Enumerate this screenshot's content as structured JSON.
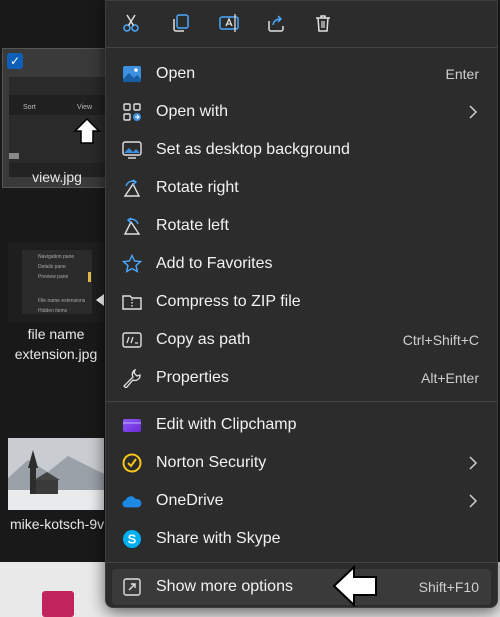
{
  "files": [
    {
      "name": "view.jpg",
      "selected": true
    },
    {
      "name": "file name extension.jpg",
      "name_line1": "file name",
      "name_line2": "extension.jpg",
      "selected": false
    },
    {
      "name": "mike-kotsch-9v",
      "selected": false
    }
  ],
  "thumb1": {
    "sort": "Sort",
    "view": "View"
  },
  "thumb2": {
    "items": [
      "Navigation pane",
      "Details pane",
      "Preview pane",
      "File name extensions",
      "Hidden items"
    ]
  },
  "quick_actions": [
    {
      "name": "cut-icon"
    },
    {
      "name": "copy-icon"
    },
    {
      "name": "rename-icon"
    },
    {
      "name": "share-icon"
    },
    {
      "name": "delete-icon"
    }
  ],
  "menu": {
    "items": [
      {
        "label": "Open",
        "shortcut": "Enter",
        "icon": "image-icon"
      },
      {
        "label": "Open with",
        "shortcut": "",
        "icon": "open-with-icon",
        "submenu": true
      },
      {
        "label": "Set as desktop background",
        "shortcut": "",
        "icon": "desktop-background-icon"
      },
      {
        "label": "Rotate right",
        "shortcut": "",
        "icon": "rotate-right-icon"
      },
      {
        "label": "Rotate left",
        "shortcut": "",
        "icon": "rotate-left-icon"
      },
      {
        "label": "Add to Favorites",
        "shortcut": "",
        "icon": "star-icon"
      },
      {
        "label": "Compress to ZIP file",
        "shortcut": "",
        "icon": "zip-folder-icon"
      },
      {
        "label": "Copy as path",
        "shortcut": "Ctrl+Shift+C",
        "icon": "copy-path-icon"
      },
      {
        "label": "Properties",
        "shortcut": "Alt+Enter",
        "icon": "wrench-icon"
      },
      {
        "label": "Edit with Clipchamp",
        "shortcut": "",
        "icon": "clipchamp-icon"
      },
      {
        "label": "Norton Security",
        "shortcut": "",
        "icon": "norton-icon",
        "submenu": true
      },
      {
        "label": "OneDrive",
        "shortcut": "",
        "icon": "onedrive-icon",
        "submenu": true
      },
      {
        "label": "Share with Skype",
        "shortcut": "",
        "icon": "skype-icon"
      },
      {
        "label": "Show more options",
        "shortcut": "Shift+F10",
        "icon": "show-more-icon"
      }
    ]
  },
  "colors": {
    "menu_bg": "#2c2c2c",
    "accent": "#4aa8ff",
    "hover": "#3a3a3a"
  }
}
